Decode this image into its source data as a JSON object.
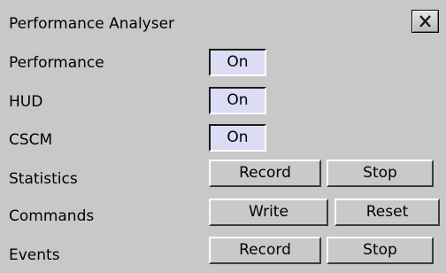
{
  "window": {
    "title": "Performance Analyser",
    "close_icon": "close-icon"
  },
  "rows": {
    "performance": {
      "label": "Performance",
      "toggle": "On"
    },
    "hud": {
      "label": "HUD",
      "toggle": "On"
    },
    "cscm": {
      "label": "CSCM",
      "toggle": "On"
    },
    "statistics": {
      "label": "Statistics",
      "primary": "Record",
      "secondary": "Stop"
    },
    "commands": {
      "label": "Commands",
      "primary": "Write",
      "secondary": "Reset"
    },
    "events": {
      "label": "Events",
      "primary": "Record",
      "secondary": "Stop"
    }
  },
  "colors": {
    "panel": "#c8c8c8",
    "toggle_on": "#dcdcf4"
  }
}
